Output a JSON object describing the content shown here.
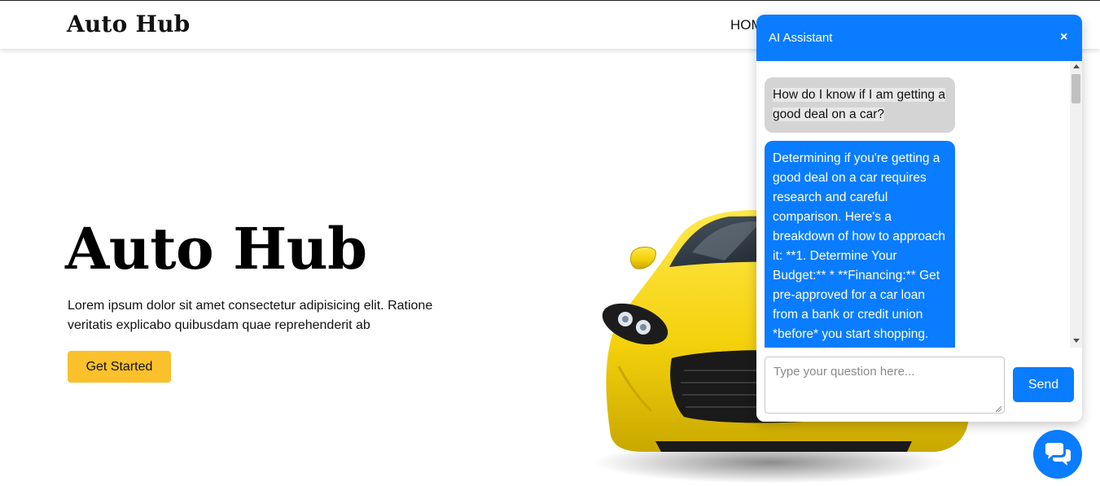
{
  "navbar": {
    "brand": "Auto Hub",
    "links": [
      "HOM"
    ]
  },
  "hero": {
    "title": "Auto Hub",
    "description": "Lorem ipsum dolor sit amet consectetur adipisicing elit. Ratione veritatis explicabo quibusdam quae reprehenderit ab",
    "cta_label": "Get Started"
  },
  "chat": {
    "title": "AI Assistant",
    "close_label": "×",
    "messages": [
      {
        "role": "user",
        "text": "How do I know if I am getting a good deal on a car?"
      },
      {
        "role": "assistant",
        "text": "Determining if you're getting a good deal on a car requires research and careful comparison. Here's a breakdown of how to approach it: **1. Determine Your Budget:** * **Financing:** Get pre-approved for a car loan from a bank or credit union *before* you start shopping. This gives you a clear understanding of"
      }
    ],
    "input_placeholder": "Type your question here...",
    "input_value": "",
    "send_label": "Send"
  },
  "icons": {
    "fab": "chat-bubbles-icon",
    "car": "yellow-sports-car-image"
  },
  "colors": {
    "accent_blue": "#0a7cff",
    "cta_yellow": "#fbc12c",
    "user_bubble": "#d4d4d4"
  }
}
